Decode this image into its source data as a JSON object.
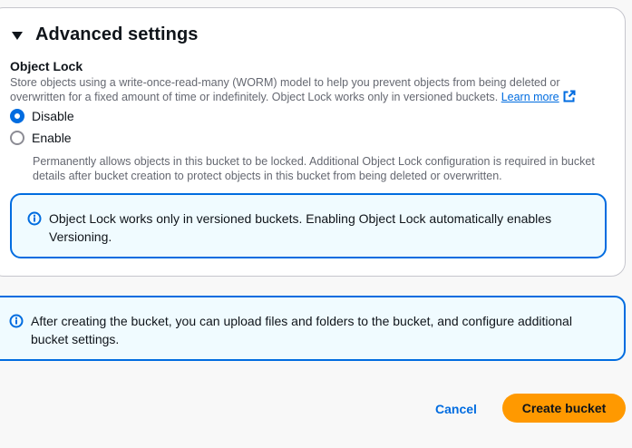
{
  "advanced_settings": {
    "title": "Advanced settings",
    "object_lock": {
      "label": "Object Lock",
      "description": "Store objects using a write-once-read-many (WORM) model to help you prevent objects from being deleted or overwritten for a fixed amount of time or indefinitely. Object Lock works only in versioned buckets.",
      "learn_more": "Learn more",
      "options": [
        {
          "label": "Disable",
          "selected": true
        },
        {
          "label": "Enable",
          "selected": false,
          "description": "Permanently allows objects in this bucket to be locked. Additional Object Lock configuration is required in bucket details after bucket creation to protect objects in this bucket from being deleted or overwritten."
        }
      ],
      "info_message": "Object Lock works only in versioned buckets. Enabling Object Lock automatically enables Versioning."
    }
  },
  "post_create_info": "After creating the bucket, you can upload files and folders to the bucket, and configure additional bucket settings.",
  "footer": {
    "cancel_label": "Cancel",
    "create_label": "Create bucket"
  },
  "icons": {
    "caret": "caret-down-icon",
    "info": "info-icon",
    "external": "external-link-icon"
  },
  "colors": {
    "primary_button": "#ff9900",
    "link": "#006ce0",
    "info_border": "#006ce0",
    "info_background": "#f0fbff"
  }
}
